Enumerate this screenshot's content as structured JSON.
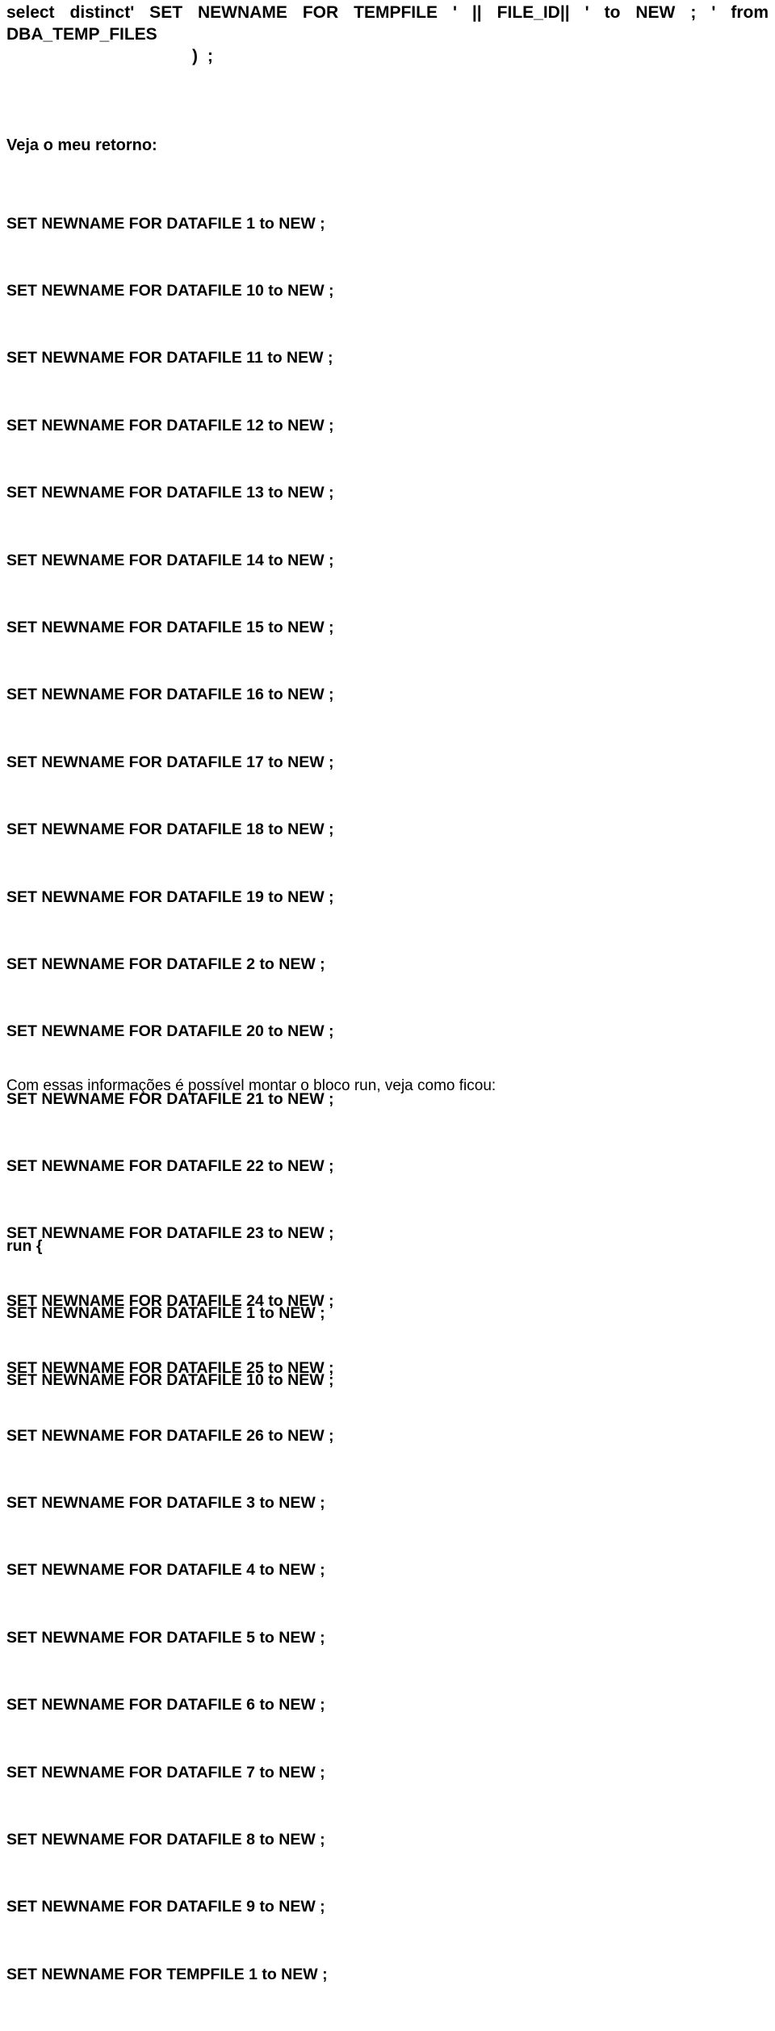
{
  "document": {
    "sql_header": {
      "line1": "select  distinct'  SET  NEWNAME  FOR  TEMPFILE  '  ||  FILE_ID||  '  to  NEW  ;  '  from",
      "line2": "DBA_TEMP_FILES",
      "closing": ") ;"
    },
    "veja_heading": "Veja o meu retorno:",
    "output_lines": [
      "SET NEWNAME FOR DATAFILE 1 to NEW ;",
      "SET NEWNAME FOR DATAFILE 10 to NEW ;",
      "SET NEWNAME FOR DATAFILE 11 to NEW ;",
      "SET NEWNAME FOR DATAFILE 12 to NEW ;",
      "SET NEWNAME FOR DATAFILE 13 to NEW ;",
      "SET NEWNAME FOR DATAFILE 14 to NEW ;",
      "SET NEWNAME FOR DATAFILE 15 to NEW ;",
      "SET NEWNAME FOR DATAFILE 16 to NEW ;",
      "SET NEWNAME FOR DATAFILE 17 to NEW ;",
      "SET NEWNAME FOR DATAFILE 18 to NEW ;",
      "SET NEWNAME FOR DATAFILE 19 to NEW ;",
      "SET NEWNAME FOR DATAFILE 2 to NEW ;",
      "SET NEWNAME FOR DATAFILE 20 to NEW ;",
      "SET NEWNAME FOR DATAFILE 21 to NEW ;",
      "SET NEWNAME FOR DATAFILE 22 to NEW ;",
      "SET NEWNAME FOR DATAFILE 23 to NEW ;",
      "SET NEWNAME FOR DATAFILE 24 to NEW ;",
      "SET NEWNAME FOR DATAFILE 25 to NEW ;",
      "SET NEWNAME FOR DATAFILE 26 to NEW ;",
      "SET NEWNAME FOR DATAFILE 3 to NEW ;",
      "SET NEWNAME FOR DATAFILE 4 to NEW ;",
      "SET NEWNAME FOR DATAFILE 5 to NEW ;",
      "SET NEWNAME FOR DATAFILE 6 to NEW ;",
      "SET NEWNAME FOR DATAFILE 7 to NEW ;",
      "SET NEWNAME FOR DATAFILE 8 to NEW ;",
      "SET NEWNAME FOR DATAFILE 9 to NEW ;",
      "SET NEWNAME FOR TEMPFILE 1 to NEW ;"
    ],
    "mid_paragraph": "Com essas informações é possível montar o bloco run, veja como ficou:",
    "run_block_lines": [
      "run {",
      "SET NEWNAME FOR DATAFILE 1 to NEW ;",
      "SET NEWNAME FOR DATAFILE 10 to NEW ;"
    ]
  },
  "colors": {
    "background": "#ffffff",
    "text": "#000000"
  }
}
